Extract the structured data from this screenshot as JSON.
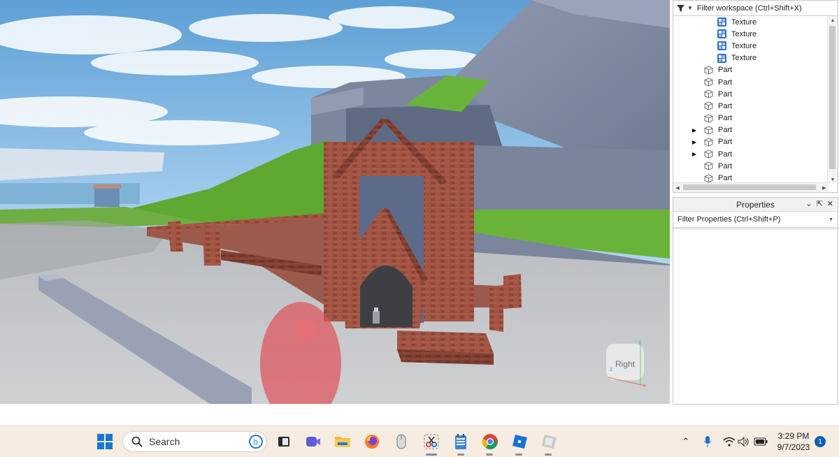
{
  "viewport": {
    "view_cube_label": "Right"
  },
  "explorer": {
    "filter_placeholder": "Filter workspace (Ctrl+Shift+X)",
    "items": [
      {
        "label": "Texture",
        "icon": "texture-icon",
        "expandable": false,
        "level": 2
      },
      {
        "label": "Texture",
        "icon": "texture-icon",
        "expandable": false,
        "level": 2
      },
      {
        "label": "Texture",
        "icon": "texture-icon",
        "expandable": false,
        "level": 2
      },
      {
        "label": "Texture",
        "icon": "texture-icon",
        "expandable": false,
        "level": 2
      },
      {
        "label": "Part",
        "icon": "part-icon",
        "expandable": false,
        "level": 1
      },
      {
        "label": "Part",
        "icon": "part-icon",
        "expandable": false,
        "level": 1
      },
      {
        "label": "Part",
        "icon": "part-icon",
        "expandable": false,
        "level": 1
      },
      {
        "label": "Part",
        "icon": "part-icon",
        "expandable": false,
        "level": 1
      },
      {
        "label": "Part",
        "icon": "part-icon",
        "expandable": false,
        "level": 1
      },
      {
        "label": "Part",
        "icon": "part-icon",
        "expandable": true,
        "level": 1
      },
      {
        "label": "Part",
        "icon": "part-icon",
        "expandable": true,
        "level": 1
      },
      {
        "label": "Part",
        "icon": "part-icon",
        "expandable": true,
        "level": 1
      },
      {
        "label": "Part",
        "icon": "part-icon",
        "expandable": false,
        "level": 1
      },
      {
        "label": "Part",
        "icon": "part-icon",
        "expandable": false,
        "level": 1
      }
    ]
  },
  "properties": {
    "title": "Properties",
    "filter_placeholder": "Filter Properties (Ctrl+Shift+P)"
  },
  "taskbar": {
    "search_label": "Search",
    "pinned": [
      {
        "name": "start-button",
        "icon": "windows-icon"
      },
      {
        "name": "bing-button",
        "icon": "bing-icon"
      },
      {
        "name": "task-view-button",
        "icon": "task-view-icon"
      },
      {
        "name": "meet-button",
        "icon": "video-call-icon"
      },
      {
        "name": "file-explorer-button",
        "icon": "folder-icon"
      },
      {
        "name": "firefox-button",
        "icon": "firefox-icon"
      },
      {
        "name": "mouse-app-button",
        "icon": "mouse-icon"
      },
      {
        "name": "snipping-tool-button",
        "icon": "scissors-icon"
      },
      {
        "name": "notepad-button",
        "icon": "notepad-icon"
      },
      {
        "name": "chrome-button",
        "icon": "chrome-icon"
      },
      {
        "name": "roblox-button",
        "icon": "roblox-icon"
      },
      {
        "name": "roblox-studio-button",
        "icon": "roblox-studio-icon"
      }
    ],
    "time": "3:29 PM",
    "date": "9/7/2023",
    "notification_count": "1"
  },
  "colors": {
    "brick": "#9b4c3c",
    "sky": "#8fc0ea",
    "grass": "#6fb63d",
    "stone_wall": "#8590a6",
    "taskbar_bg": "#f6ece2",
    "accent": "#0a5fb4"
  }
}
